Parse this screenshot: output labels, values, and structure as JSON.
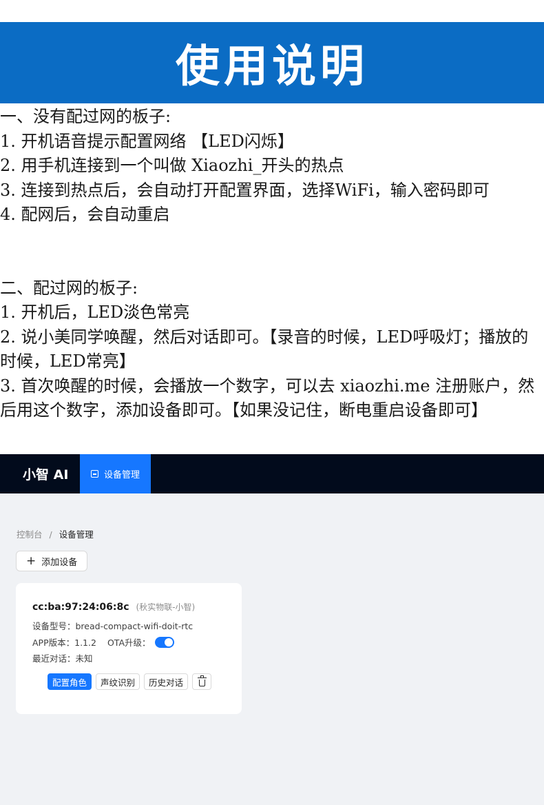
{
  "banner": {
    "title": "使用说明"
  },
  "section1": {
    "heading": "一、没有配过网的板子:",
    "steps": [
      "1. 开机语音提示配置网络 【LED闪烁】",
      "2. 用手机连接到一个叫做 Xiaozhi_开头的热点",
      "3. 连接到热点后，会自动打开配置界面，选择WiFi，输入密码即可",
      "4. 配网后，会自动重启"
    ]
  },
  "section2": {
    "heading": "二、配过网的板子:",
    "steps": [
      "1. 开机后，LED淡色常亮",
      "2. 说小美同学唤醒，然后对话即可。【录音的时候，LED呼吸灯；播放的时候，LED常亮】",
      "3. 首次唤醒的时候，会播放一个数字，可以去 xiaozhi.me 注册账户，然后用这个数字，添加设备即可。【如果没记住，断电重启设备即可】"
    ]
  },
  "app": {
    "brand": "小智 AI",
    "nav_item": "设备管理",
    "nav_icon": "device-icon",
    "breadcrumb": {
      "root": "控制台",
      "separator": "/",
      "current": "设备管理"
    },
    "add_button": "添加设备",
    "card": {
      "mac": "cc:ba:97:24:06:8c",
      "owner": "(秋实物联-小智)",
      "model": "设备型号：bread-compact-wifi-doit-rtc",
      "app_version": "APP版本：1.1.2",
      "ota_label": "OTA升级：",
      "ota_enabled": true,
      "last_chat": "最近对话：未知",
      "actions": {
        "configure": "配置角色",
        "voiceprint": "声纹识别",
        "history": "历史对话",
        "delete_icon": "trash-icon"
      }
    },
    "colors": {
      "accent": "#1677ff",
      "topbar": "#020b1c",
      "banner": "#0b6cc4"
    }
  }
}
